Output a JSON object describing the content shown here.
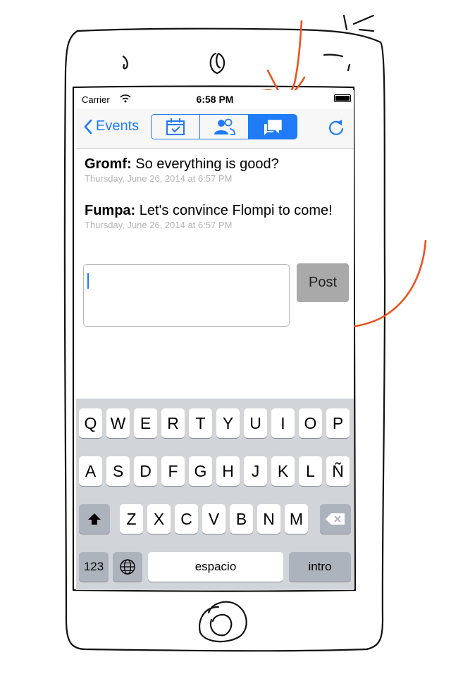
{
  "status_bar": {
    "carrier": "Carrier",
    "time": "6:58 PM"
  },
  "nav": {
    "back_label": "Events",
    "segments": [
      {
        "icon": "calendar-icon",
        "selected": false
      },
      {
        "icon": "people-icon",
        "selected": false
      },
      {
        "icon": "chat-bubbles-icon",
        "selected": true
      }
    ],
    "refresh_icon": "refresh-icon"
  },
  "messages": [
    {
      "author": "Gromf:",
      "text": "So everything is good?",
      "date": "Thursday, June 26, 2014 at 6:57 PM"
    },
    {
      "author": "Fumpa:",
      "text": "Let's convince Flompi to come!",
      "date": "Thursday, June 26, 2014 at 6:57 PM"
    }
  ],
  "compose": {
    "value": "",
    "placeholder": "",
    "post_label": "Post"
  },
  "keyboard": {
    "row1": [
      "Q",
      "W",
      "E",
      "R",
      "T",
      "Y",
      "U",
      "I",
      "O",
      "P"
    ],
    "row2": [
      "A",
      "S",
      "D",
      "F",
      "G",
      "H",
      "J",
      "K",
      "L",
      "Ñ"
    ],
    "row3": [
      "Z",
      "X",
      "C",
      "V",
      "B",
      "N",
      "M"
    ],
    "numbers_label": "123",
    "space_label": "espacio",
    "return_label": "intro",
    "shift_icon": "shift-icon",
    "delete_icon": "backspace-icon",
    "globe_icon": "globe-icon"
  },
  "colors": {
    "accent": "#1f7bf6",
    "annotation": "#e8541e",
    "keyboard_bg": "#d1d4d9"
  }
}
